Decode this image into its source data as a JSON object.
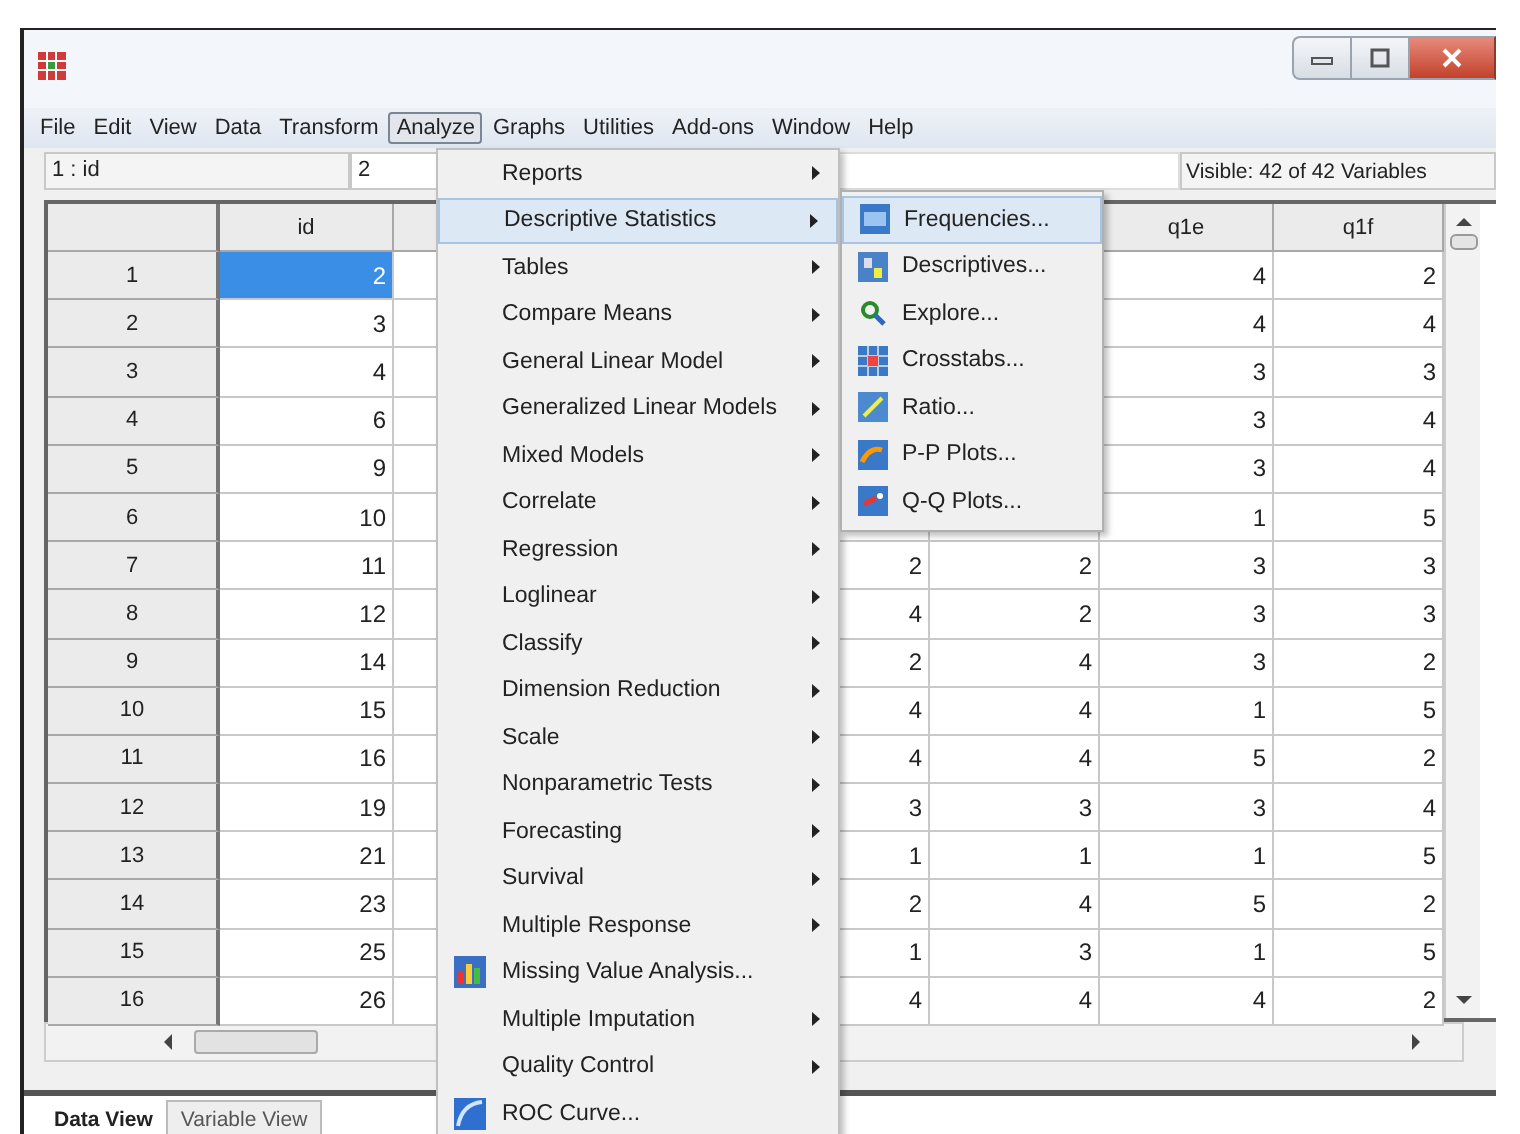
{
  "menu_bar": [
    {
      "label": "File",
      "selected": false
    },
    {
      "label": "Edit",
      "selected": false
    },
    {
      "label": "View",
      "selected": false
    },
    {
      "label": "Data",
      "selected": false
    },
    {
      "label": "Transform",
      "selected": false
    },
    {
      "label": "Analyze",
      "selected": true
    },
    {
      "label": "Graphs",
      "selected": false
    },
    {
      "label": "Utilities",
      "selected": false
    },
    {
      "label": "Add-ons",
      "selected": false
    },
    {
      "label": "Window",
      "selected": false
    },
    {
      "label": "Help",
      "selected": false
    }
  ],
  "cell_editor": {
    "cell": "1 : id",
    "value": "2"
  },
  "visible_variables": "Visible: 42 of 42 Variables",
  "table": {
    "columns": [
      "id",
      null,
      null,
      null,
      "q1e",
      "q1f"
    ],
    "rows": [
      {
        "number": "1",
        "selected": true,
        "cells": [
          "2",
          null,
          null,
          null,
          "4",
          "2"
        ]
      },
      {
        "number": "2",
        "selected": false,
        "cells": [
          "3",
          null,
          null,
          null,
          "4",
          "4"
        ]
      },
      {
        "number": "3",
        "selected": false,
        "cells": [
          "4",
          null,
          null,
          null,
          "3",
          "3"
        ]
      },
      {
        "number": "4",
        "selected": false,
        "cells": [
          "6",
          null,
          null,
          null,
          "3",
          "4"
        ]
      },
      {
        "number": "5",
        "selected": false,
        "cells": [
          "9",
          null,
          null,
          null,
          "3",
          "4"
        ]
      },
      {
        "number": "6",
        "selected": false,
        "cells": [
          "10",
          null,
          null,
          null,
          "1",
          "5"
        ]
      },
      {
        "number": "7",
        "selected": false,
        "cells": [
          "11",
          null,
          "2",
          "2",
          "3",
          "3"
        ]
      },
      {
        "number": "8",
        "selected": false,
        "cells": [
          "12",
          null,
          "4",
          "2",
          "3",
          "3"
        ]
      },
      {
        "number": "9",
        "selected": false,
        "cells": [
          "14",
          null,
          "2",
          "4",
          "3",
          "2"
        ]
      },
      {
        "number": "10",
        "selected": false,
        "cells": [
          "15",
          null,
          "4",
          "4",
          "1",
          "5"
        ]
      },
      {
        "number": "11",
        "selected": false,
        "cells": [
          "16",
          null,
          "4",
          "4",
          "5",
          "2"
        ]
      },
      {
        "number": "12",
        "selected": false,
        "cells": [
          "19",
          null,
          "3",
          "3",
          "3",
          "4"
        ]
      },
      {
        "number": "13",
        "selected": false,
        "cells": [
          "21",
          null,
          "1",
          "1",
          "1",
          "5"
        ]
      },
      {
        "number": "14",
        "selected": false,
        "cells": [
          "23",
          null,
          "2",
          "4",
          "5",
          "2"
        ]
      },
      {
        "number": "15",
        "selected": false,
        "cells": [
          "25",
          null,
          "1",
          "3",
          "1",
          "5"
        ]
      },
      {
        "number": "16",
        "selected": false,
        "cells": [
          "26",
          null,
          "4",
          "4",
          "4",
          "2"
        ]
      }
    ]
  },
  "analyze_menu": {
    "items": [
      {
        "label": "Reports",
        "kind": "submenu",
        "selected": false
      },
      {
        "label": "Descriptive Statistics",
        "kind": "submenu",
        "selected": true
      },
      {
        "label": "Tables",
        "kind": "submenu",
        "selected": false
      },
      {
        "label": "Compare Means",
        "kind": "submenu",
        "selected": false
      },
      {
        "label": "General Linear Model",
        "kind": "submenu",
        "selected": false
      },
      {
        "label": "Generalized Linear Models",
        "kind": "submenu",
        "selected": false
      },
      {
        "label": "Mixed Models",
        "kind": "submenu",
        "selected": false
      },
      {
        "label": "Correlate",
        "kind": "submenu",
        "selected": false
      },
      {
        "label": "Regression",
        "kind": "submenu",
        "selected": false
      },
      {
        "label": "Loglinear",
        "kind": "submenu",
        "selected": false
      },
      {
        "label": "Classify",
        "kind": "submenu",
        "selected": false
      },
      {
        "label": "Dimension Reduction",
        "kind": "submenu",
        "selected": false
      },
      {
        "label": "Scale",
        "kind": "submenu",
        "selected": false
      },
      {
        "label": "Nonparametric Tests",
        "kind": "submenu",
        "selected": false
      },
      {
        "label": "Forecasting",
        "kind": "submenu",
        "selected": false
      },
      {
        "label": "Survival",
        "kind": "submenu",
        "selected": false
      },
      {
        "label": "Multiple Response",
        "kind": "submenu",
        "selected": false
      },
      {
        "label": "Missing Value Analysis...",
        "kind": "command",
        "selected": false
      },
      {
        "label": "Multiple Imputation",
        "kind": "submenu",
        "selected": false
      },
      {
        "label": "Quality Control",
        "kind": "submenu",
        "selected": false
      },
      {
        "label": "ROC Curve...",
        "kind": "command",
        "selected": false
      }
    ]
  },
  "descriptive_statistics_menu": {
    "items": [
      {
        "label": "Frequencies...",
        "selected": true
      },
      {
        "label": "Descriptives...",
        "selected": false
      },
      {
        "label": "Explore...",
        "selected": false
      },
      {
        "label": "Crosstabs...",
        "selected": false
      },
      {
        "label": "Ratio...",
        "selected": false
      },
      {
        "label": "P-P Plots...",
        "selected": false
      },
      {
        "label": "Q-Q Plots...",
        "selected": false
      }
    ]
  },
  "view_tabs": [
    {
      "label": "Data View",
      "selected": true
    },
    {
      "label": "Variable View",
      "selected": false
    }
  ]
}
